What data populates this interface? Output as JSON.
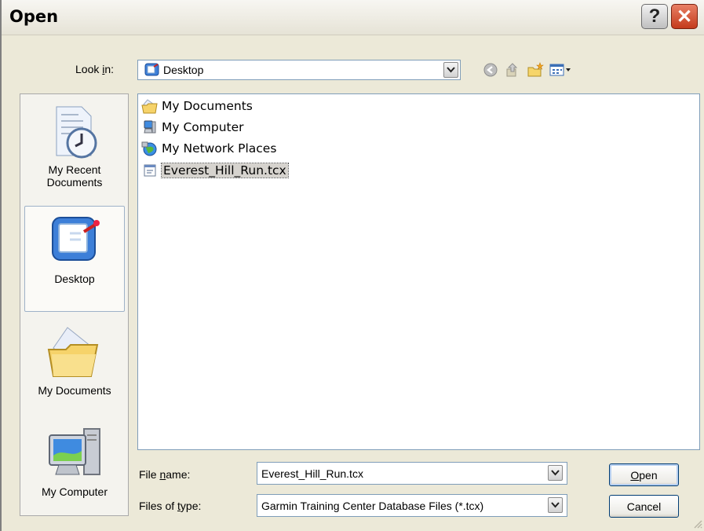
{
  "window": {
    "title": "Open"
  },
  "titlebar": {
    "help_glyph": "?",
    "close_glyph": "✕"
  },
  "lookin": {
    "label": "Look in:",
    "label_pre": "Look ",
    "label_key": "i",
    "label_post": "n:",
    "value": "Desktop",
    "icon": "desktop-icon"
  },
  "toolbar": {
    "back_icon": "back-arrow-icon",
    "up_icon": "up-folder-icon",
    "new_folder_icon": "new-folder-icon",
    "views_icon": "views-menu-icon"
  },
  "places": [
    {
      "line1": "My Recent",
      "line2": "Documents",
      "icon": "recent-documents-icon"
    },
    {
      "line1": "Desktop",
      "line2": "",
      "icon": "desktop-icon",
      "selected": true
    },
    {
      "line1": "My Documents",
      "line2": "",
      "icon": "my-documents-folder-icon"
    },
    {
      "line1": "My Computer",
      "line2": "",
      "icon": "my-computer-icon"
    }
  ],
  "files": [
    {
      "name": "My Documents",
      "icon": "my-documents-folder-icon"
    },
    {
      "name": "My Computer",
      "icon": "my-computer-icon"
    },
    {
      "name": "My Network Places",
      "icon": "network-places-icon"
    },
    {
      "name": "Everest_Hill_Run.tcx",
      "icon": "tcx-file-icon",
      "selected": true
    }
  ],
  "filename": {
    "label_pre": "File ",
    "label_key": "n",
    "label_post": "ame:",
    "value": "Everest_Hill_Run.tcx"
  },
  "filetype": {
    "label_pre": "Files of ",
    "label_key": "t",
    "label_post": "ype:",
    "value": "Garmin Training Center Database Files (*.tcx)"
  },
  "buttons": {
    "open_key": "O",
    "open_rest": "pen",
    "cancel": "Cancel"
  },
  "colors": {
    "selection": "#d6d3ce",
    "field_border": "#7f9db9",
    "window_bg": "#ece9d8",
    "close": "#c43b1c"
  }
}
